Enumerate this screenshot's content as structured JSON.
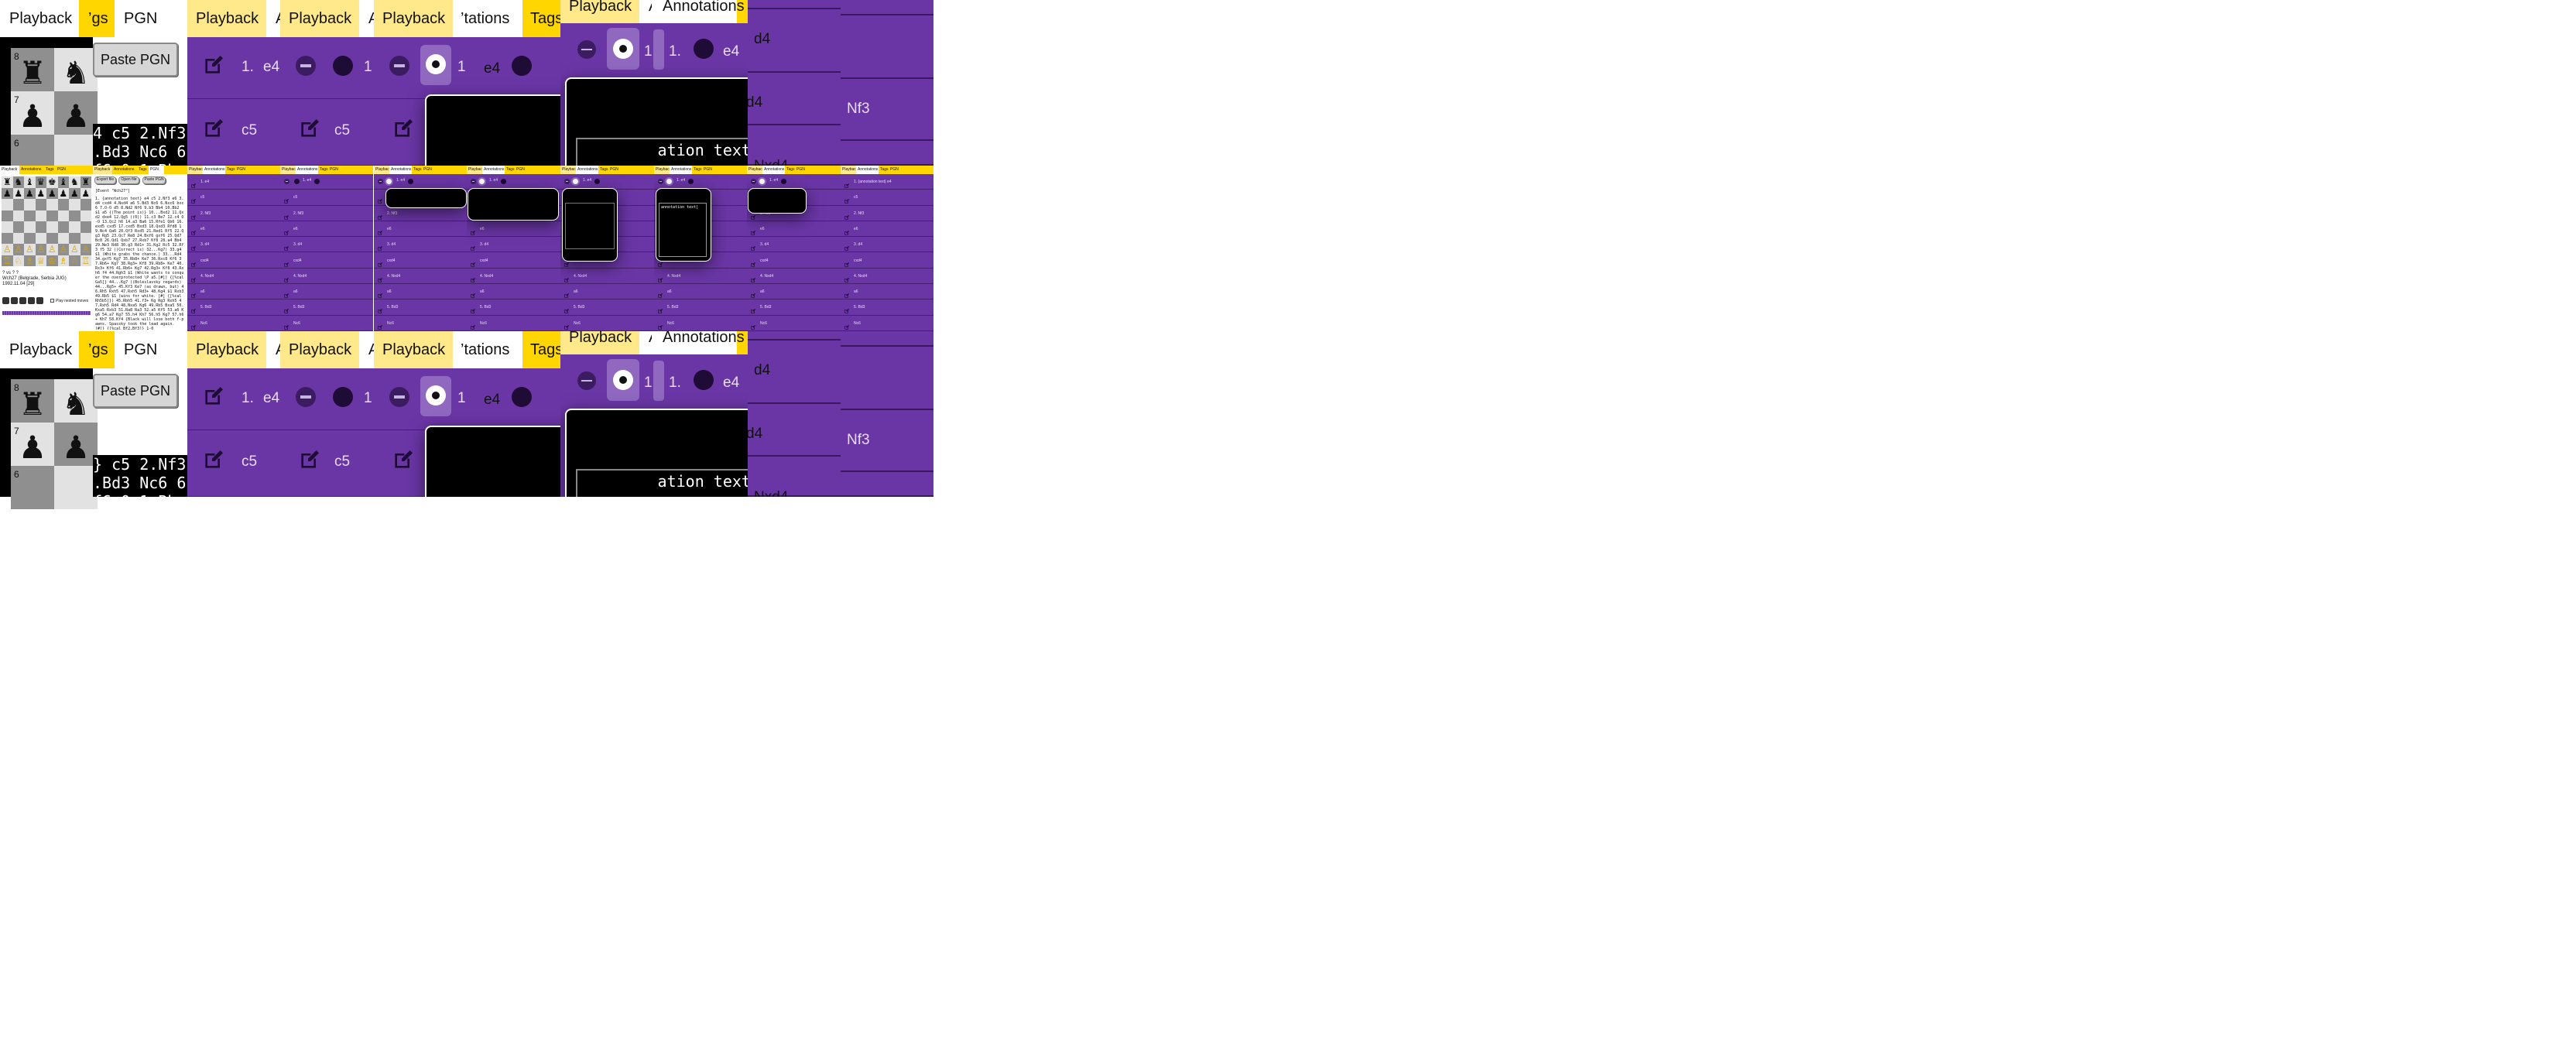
{
  "tabs": {
    "playback": "Playback",
    "annotations": "Annotations",
    "tags": "Tags",
    "pgn": "PGN",
    "tags_clipped": "’gs",
    "annotations_clipped": "’tations",
    "playback_tail": "A"
  },
  "pgn_panel": {
    "paste_pgn": "Paste PGN",
    "export_file": "Export file",
    "open_file": "Open file",
    "pgn_text_line1": "4 c5 2.Nf3",
    "pgn_text_line2": ".Bd3 Nc6 6",
    "pgn_text_line3": "f6 0 1 Bb",
    "pgn_text_line1_b": "} c5 2.Nf3",
    "event_line": "[Event \"Wch27\"]",
    "pgn_body": "1. {annotation text} e4 c5 2.Nf3 e6 3.d4 cxd4 4.Nxd4 a6 5.Bd3 Nc6 6.Nxc6 bxc6 7.O-O d5 8.Nd2 Nf6 9.b3 Bb4 10.Bb2 $1 a5 {(The point is)} 10...Bxd2 11.Qxd2 dxe4 12.Qg5 ((0)) 11.c3 Be7 12.c4 O-O 13.Qc2 h6 14.a3 Ba6 15.Rfe1 Qb6 16.exd5 cxd5 17.cxd5 Bxd3 18.Qxd3 Rfd8 19.Nc4 Qa6 20.Qf3 Rxd5 21.Red1 Rf5 22.Qg3 Rg5 23.Qc7 Re8 24.Bxf6 gxf6 25.Qd7 Bc8 26.Qd1 Qxb7 27.Rxb7 Kf8 28.a4 Bb4 29.Ne3 Rd8 30.g3 Rd1+ 31.Kg2 Rc5 32.Rf3 f5 32 ((Correct is) 32...Kg7) 33.g4 $1 (White grabs the chance.) 33...Rd4 34.gxf5 Kg7 35.Rb8+ Ke7 36.Rxc8 Kf6 37.Rb6+ Kg7 38.Rg3+ Kf8 39.Rb8+ Ke7 40.Rx3+ Kf6 41.Rb6+ Kg7 42.Rg3+ Kf8 43.Rxh6 f4 44.Rgh3 $1 (White wants to conquer the overprotected \\P a5.[#]) {[%cal Ga5]} 44...Kg7 ((Boleslavsky regards) 44...Rg5+ 45.Kf3 Ke7 (as drawn, but) 46.Rh5 Rxh5 47.Rxh5 Rd3+ 48.Kg4 $1 Rxb3 49.Rb5 $1 (wins for white. [#] {[%cal Rh5b5]}) 45.Rbh5 41.f3+ Kg Rg3 Rxh5 47.Rxh5 Rd4 48.Nxa5 Kg6 49.Rb5 Bxa5 50.Kxa5 Rxb3 51.Ra8 Ra3 52.a5 Kf5 53.a6 Kg6 54.a7 Kg7 55.h4 Kh7 56.h5 Kg7 57.h6+ Kh7 58.Kf4 {Black will lose both f-pawns. Spassky took the lead again. [#]} {[%cal Bf2,Bf3]} 1-0",
    "players": "? vs ? ?",
    "event_info": "Wch27 (Belgrade, Serbia JUG)",
    "date_info": "1992.11.04 [29]",
    "play_nested": "Play nested moves",
    "rank_8": "8",
    "rank_7": "7",
    "rank_6": "6",
    "rank_5": "5",
    "rank_4": "4",
    "rank_3": "3",
    "rank_2": "2",
    "rank_1": "1"
  },
  "moves": {
    "m1": "1.",
    "e4": "e4",
    "c5": "c5",
    "nf3": "Nf3",
    "e6": "e6",
    "d4": "d4",
    "cxd4": "cxd4",
    "nxd4": "Nxd4",
    "a6": "a6",
    "bd3": "Bd3",
    "nc6": "Nc6",
    "row1_small": "1. e4",
    "row2_small": "2. Nf3",
    "row3_small": "3. d4",
    "row4_small": "4. Nxd4",
    "row5_small": "5. Bd3",
    "annot_row1": "1. {annotation text} e4",
    "partial_1": "1",
    "partial_1dot": "1.",
    "nxd4_top": "Nxd4"
  },
  "annotation": {
    "text": "ation text|",
    "small_text": "annotation text|"
  },
  "colors": {
    "tab_gold": "#ffd600",
    "tab_pale": "#ffe98a",
    "purple": "#6a36a6",
    "highlight": "#9068c0"
  }
}
